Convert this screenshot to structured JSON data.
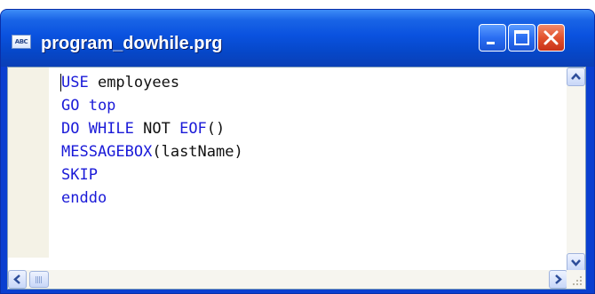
{
  "window": {
    "title": "program_dowhile.prg",
    "app_icon_text": "ABC",
    "icon": "text-document-icon"
  },
  "title_buttons": {
    "minimize": "minimize-icon",
    "maximize": "maximize-icon",
    "close": "close-icon"
  },
  "editor": {
    "lines": [
      [
        {
          "text": "USE",
          "kind": "kw"
        },
        {
          "text": " employees",
          "kind": "id"
        }
      ],
      [
        {
          "text": "GO top",
          "kind": "kw"
        }
      ],
      [
        {
          "text": "DO WHILE",
          "kind": "kw"
        },
        {
          "text": " NOT ",
          "kind": "id"
        },
        {
          "text": "EOF",
          "kind": "fn"
        },
        {
          "text": "()",
          "kind": "id"
        }
      ],
      [
        {
          "text": "MESSAGEBOX",
          "kind": "fn"
        },
        {
          "text": "(lastName)",
          "kind": "id"
        }
      ],
      [
        {
          "text": "SKIP",
          "kind": "kw"
        }
      ],
      [
        {
          "text": "enddo",
          "kind": "kw"
        }
      ]
    ]
  },
  "colors": {
    "titlebar": "#0a52df",
    "keyword": "#1a1ad8",
    "text": "#111111",
    "close_button": "#e2522d"
  }
}
